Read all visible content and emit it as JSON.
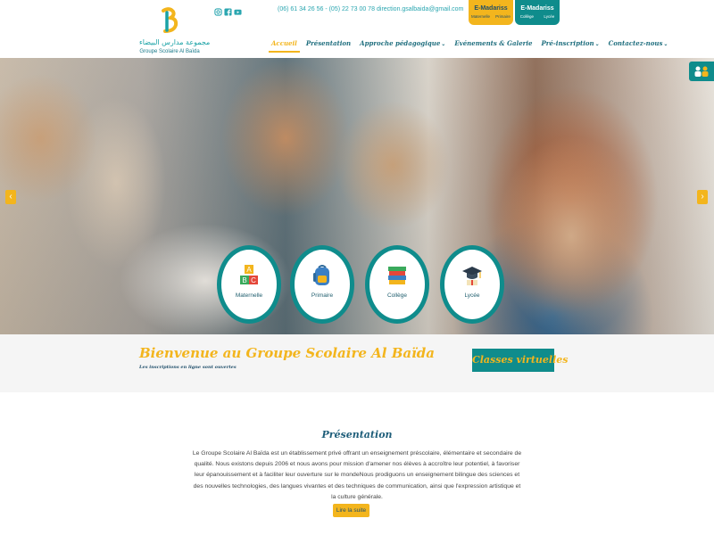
{
  "header": {
    "logo": {
      "arabic": "مجموعة مدارس البيضاء",
      "latin": "Groupe Scolaire Al Baïda"
    },
    "social_icons": [
      "instagram-icon",
      "facebook-icon",
      "youtube-icon"
    ],
    "phones": "(06) 61 34 26 56 - (05) 22 73 00 78",
    "email": "direction.gsalbaida@gmail.com",
    "emadariss": [
      {
        "title": "E-Madariss",
        "left": "Maternelle",
        "right": "Primaire",
        "color": "#f3b51d"
      },
      {
        "title": "E-Madariss",
        "left": "Collège",
        "right": "Lycée",
        "color": "#0f8c8c"
      }
    ],
    "nav": [
      {
        "label": "Accueil",
        "active": true,
        "dropdown": false
      },
      {
        "label": "Présentation",
        "active": false,
        "dropdown": false
      },
      {
        "label": "Approche pédagogique",
        "active": false,
        "dropdown": true
      },
      {
        "label": "Evénements & Galerie",
        "active": false,
        "dropdown": false
      },
      {
        "label": "Pré-inscription",
        "active": false,
        "dropdown": true
      },
      {
        "label": "Contactez-nous",
        "active": false,
        "dropdown": true
      }
    ]
  },
  "hero": {
    "prev_arrow": "‹",
    "next_arrow": "›",
    "levels": [
      {
        "label": "Maternelle",
        "icon": "abc-blocks-icon"
      },
      {
        "label": "Primaire",
        "icon": "backpack-icon"
      },
      {
        "label": "Collège",
        "icon": "books-icon"
      },
      {
        "label": "Lycée",
        "icon": "graduation-cap-icon"
      }
    ]
  },
  "welcome": {
    "title": "Bienvenue au Groupe Scolaire Al Baïda",
    "subtitle": "Les inscriptions en ligne sont ouvertes",
    "virtual_button": "Classes virtuelles"
  },
  "presentation": {
    "title": "Présentation",
    "text": "Le Groupe Scolaire Al Baïda est un établissement privé offrant un enseignement préscolaire, élémentaire et secondaire de qualité. Nous existons depuis 2006 et nous avons pour mission d'amener nos élèves à accroître leur potentiel, à favoriser leur épanouissement et à faciliter leur ouverture sur le mondeNous prodiguons un enseignement bilingue des sciences et des nouvelles technologies, des langues vivantes et des techniques de communication, ainsi que l'expression artistique et la culture générale.",
    "read_more": "Lire la suite"
  },
  "colors": {
    "accent_yellow": "#f3b51d",
    "accent_teal": "#0f8c8c",
    "navy": "#1f4e6a"
  }
}
